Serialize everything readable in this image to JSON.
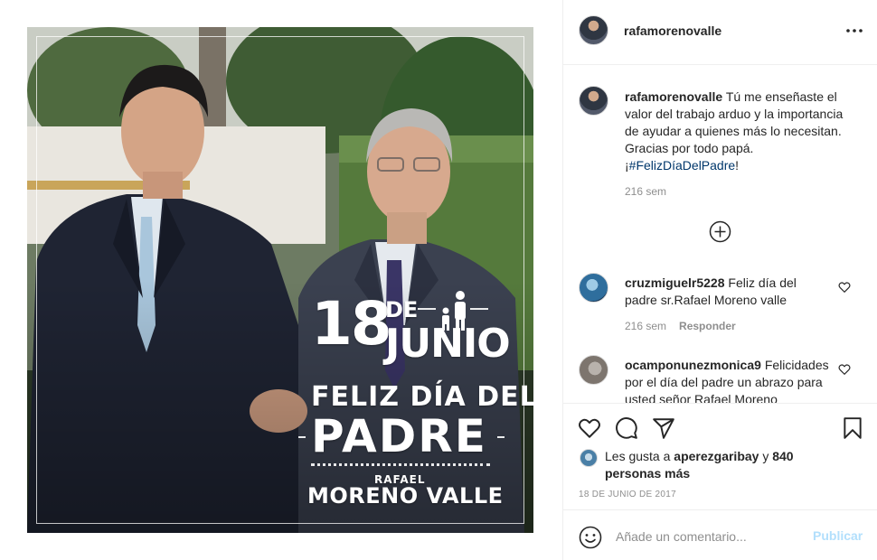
{
  "post": {
    "overlay": {
      "day": "18",
      "de": "DE",
      "month": "JUNIO",
      "feliz": "FELIZ DÍA DEL",
      "padre": "PADRE",
      "firstname": "RAFAEL",
      "lastname": "MORENO VALLE"
    }
  },
  "header": {
    "username": "rafamorenovalle",
    "more_icon": "more-horizontal-icon"
  },
  "caption": {
    "username": "rafamorenovalle",
    "text": "Tú me enseñaste el valor del trabajo arduo y la importancia de ayudar a quienes más lo necesitan. Gracias por todo papá. ¡",
    "hashtag": "#FelizDíaDelPadre",
    "suffix": "!",
    "time": "216 sem"
  },
  "load_more_icon": "plus-circle-icon",
  "comments": [
    {
      "username": "cruzmiguelr5228",
      "text": "Feliz día del padre sr.Rafael Moreno valle",
      "time": "216 sem",
      "reply": "Responder"
    },
    {
      "username": "ocamponunezmonica9",
      "text": "Felicidades por el día del padre un abrazo para usted señor Rafael Moreno",
      "time": "",
      "reply": ""
    }
  ],
  "actions": {
    "icons": [
      "heart-icon",
      "comment-icon",
      "share-icon",
      "bookmark-icon"
    ]
  },
  "likes": {
    "prefix": "Les gusta a ",
    "user": "aperezgaribay",
    "middle": " y ",
    "count": "840 personas más"
  },
  "date": "18 DE JUNIO DE 2017",
  "add_comment": {
    "placeholder": "Añade un comentario...",
    "publish": "Publicar",
    "emoji_icon": "emoji-icon"
  },
  "colors": {
    "text": "#262626",
    "secondary": "#8e8e8e",
    "hashtag": "#00376b",
    "publish_disabled": "#b2dffc",
    "divider": "#efefef"
  }
}
